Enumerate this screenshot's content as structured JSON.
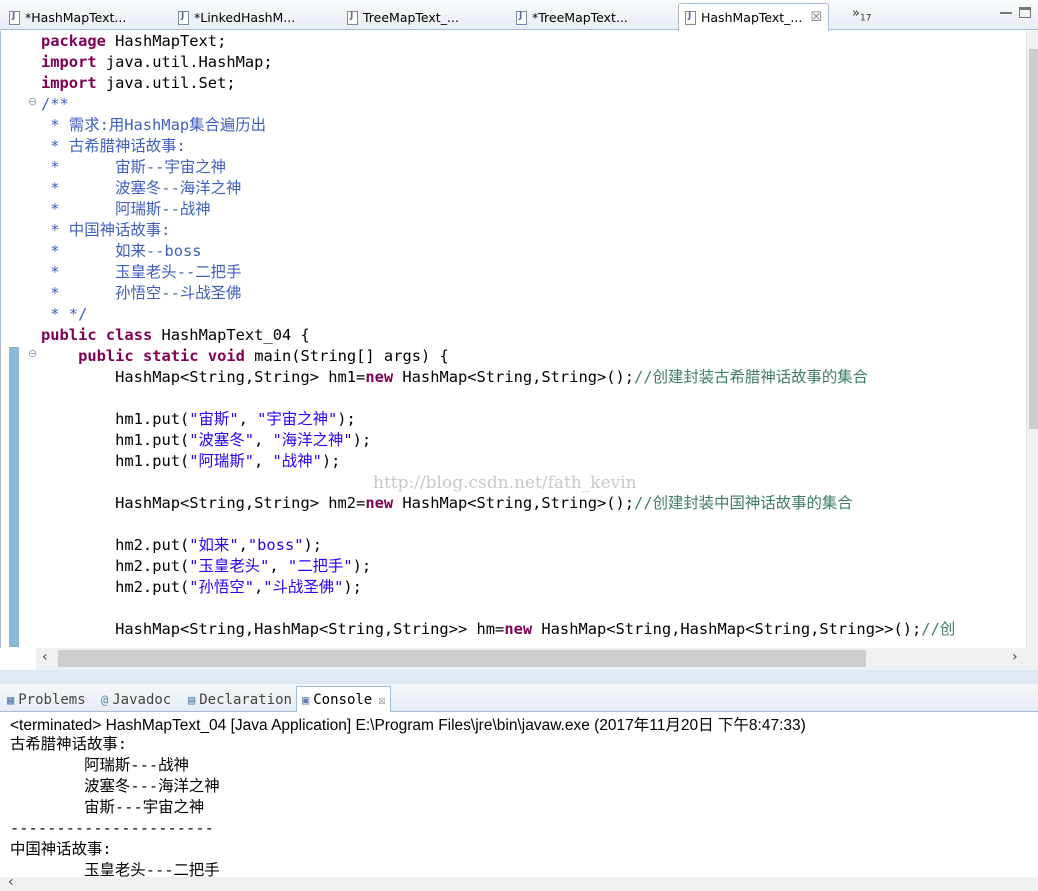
{
  "editor_tabs": [
    {
      "label": "*HashMapText...",
      "active": false,
      "closable": false
    },
    {
      "label": "*LinkedHashM...",
      "active": false,
      "closable": false
    },
    {
      "label": "TreeMapText_...",
      "active": false,
      "closable": false
    },
    {
      "label": "*TreeMapText...",
      "active": false,
      "closable": false
    },
    {
      "label": "HashMapText_...",
      "active": true,
      "closable": true
    }
  ],
  "tab_overflow": {
    "label": "»",
    "count": "17"
  },
  "code_lines": [
    [
      [
        "package",
        "kw"
      ],
      [
        " HashMapText;",
        ""
      ]
    ],
    [
      [
        "import",
        "kw"
      ],
      [
        " java.util.HashMap;",
        ""
      ]
    ],
    [
      [
        "import",
        "kw"
      ],
      [
        " java.util.Set;",
        ""
      ]
    ],
    [
      [
        "/**",
        "cm"
      ]
    ],
    [
      [
        " * 需求:用HashMap集合遍历出",
        "cm"
      ]
    ],
    [
      [
        " * 古希腊神话故事:",
        "cm"
      ]
    ],
    [
      [
        " *      宙斯--宇宙之神",
        "cm"
      ]
    ],
    [
      [
        " *      波塞冬--海洋之神",
        "cm"
      ]
    ],
    [
      [
        " *      阿瑞斯--战神",
        "cm"
      ]
    ],
    [
      [
        " * 中国神话故事:",
        "cm"
      ]
    ],
    [
      [
        " *      如来--boss",
        "cm"
      ]
    ],
    [
      [
        " *      玉皇老头--二把手",
        "cm"
      ]
    ],
    [
      [
        " *      孙悟空--斗战圣佛",
        "cm"
      ]
    ],
    [
      [
        " * */",
        "cm"
      ]
    ],
    [
      [
        "public",
        "kw"
      ],
      [
        " ",
        ""
      ],
      [
        "class",
        "kw"
      ],
      [
        " HashMapText_04 {",
        ""
      ]
    ],
    [
      [
        "    ",
        ""
      ],
      [
        "public",
        "kw"
      ],
      [
        " ",
        ""
      ],
      [
        "static",
        "kw"
      ],
      [
        " ",
        ""
      ],
      [
        "void",
        "kw"
      ],
      [
        " main(String[] args) {",
        ""
      ]
    ],
    [
      [
        "        HashMap<String,String> hm1=",
        ""
      ],
      [
        "new",
        "kw"
      ],
      [
        " HashMap<String,String>();",
        ""
      ],
      [
        "//创建封装古希腊神话故事的集合",
        "lc"
      ]
    ],
    [
      [
        "",
        ""
      ]
    ],
    [
      [
        "        hm1.put(",
        ""
      ],
      [
        "\"宙斯\"",
        "st"
      ],
      [
        ", ",
        ""
      ],
      [
        "\"宇宙之神\"",
        "st"
      ],
      [
        ");",
        ""
      ]
    ],
    [
      [
        "        hm1.put(",
        ""
      ],
      [
        "\"波塞冬\"",
        "st"
      ],
      [
        ", ",
        ""
      ],
      [
        "\"海洋之神\"",
        "st"
      ],
      [
        ");",
        ""
      ]
    ],
    [
      [
        "        hm1.put(",
        ""
      ],
      [
        "\"阿瑞斯\"",
        "st"
      ],
      [
        ", ",
        ""
      ],
      [
        "\"战神\"",
        "st"
      ],
      [
        ");",
        ""
      ]
    ],
    [
      [
        "",
        ""
      ]
    ],
    [
      [
        "        HashMap<String,String> hm2=",
        ""
      ],
      [
        "new",
        "kw"
      ],
      [
        " HashMap<String,String>();",
        ""
      ],
      [
        "//创建封装中国神话故事的集合",
        "lc"
      ]
    ],
    [
      [
        "",
        ""
      ]
    ],
    [
      [
        "        hm2.put(",
        ""
      ],
      [
        "\"如来\"",
        "st"
      ],
      [
        ",",
        ""
      ],
      [
        "\"boss\"",
        "st"
      ],
      [
        ");",
        ""
      ]
    ],
    [
      [
        "        hm2.put(",
        ""
      ],
      [
        "\"玉皇老头\"",
        "st"
      ],
      [
        ", ",
        ""
      ],
      [
        "\"二把手\"",
        "st"
      ],
      [
        ");",
        ""
      ]
    ],
    [
      [
        "        hm2.put(",
        ""
      ],
      [
        "\"孙悟空\"",
        "st"
      ],
      [
        ",",
        ""
      ],
      [
        "\"斗战圣佛\"",
        "st"
      ],
      [
        ");",
        ""
      ]
    ],
    [
      [
        "",
        ""
      ]
    ],
    [
      [
        "        HashMap<String,HashMap<String,String>> hm=",
        ""
      ],
      [
        "new",
        "kw"
      ],
      [
        " HashMap<String,HashMap<String,String>>();",
        ""
      ],
      [
        "//创",
        "lc"
      ]
    ]
  ],
  "watermark": "http://blog.csdn.net/fath_kevin",
  "view_tabs": [
    {
      "label": "Problems",
      "icon": "problems-icon",
      "glyph": "▦",
      "active": false
    },
    {
      "label": "Javadoc",
      "icon": "javadoc-icon",
      "glyph": "@",
      "active": false
    },
    {
      "label": "Declaration",
      "icon": "declaration-icon",
      "glyph": "▤",
      "active": false
    },
    {
      "label": "Console",
      "icon": "console-icon",
      "glyph": "▣",
      "active": true,
      "closable": true
    }
  ],
  "console": {
    "description": "<terminated> HashMapText_04 [Java Application] E:\\Program Files\\jre\\bin\\javaw.exe (2017年11月20日 下午8:47:33)",
    "output": [
      "古希腊神话故事:",
      "        阿瑞斯---战神",
      "        波塞冬---海洋之神",
      "        宙斯---宇宙之神",
      "----------------------",
      "中国神话故事:",
      "        玉皇老头---二把手"
    ]
  },
  "colors": {
    "keyword": "#7f0055",
    "comment": "#3f5fbf",
    "line_comment": "#3f7f5f",
    "string": "#2a00ff"
  }
}
